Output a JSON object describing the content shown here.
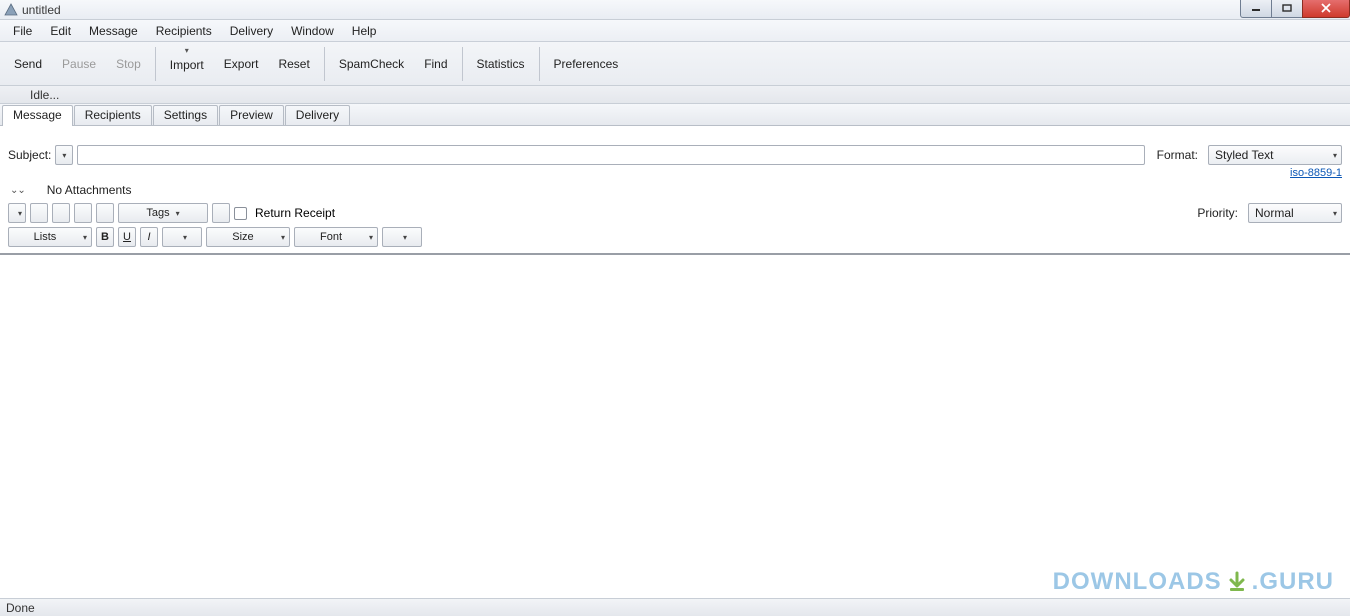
{
  "window": {
    "title": "untitled"
  },
  "menubar": [
    "File",
    "Edit",
    "Message",
    "Recipients",
    "Delivery",
    "Window",
    "Help"
  ],
  "toolbar": {
    "send": "Send",
    "pause": "Pause",
    "stop": "Stop",
    "import": "Import",
    "export": "Export",
    "reset": "Reset",
    "spamcheck": "SpamCheck",
    "find": "Find",
    "statistics": "Statistics",
    "preferences": "Preferences"
  },
  "status_idle": "Idle...",
  "tabs": [
    "Message",
    "Recipients",
    "Settings",
    "Preview",
    "Delivery"
  ],
  "subject_label": "Subject:",
  "subject_value": "",
  "format_label": "Format:",
  "format_value": "Styled Text",
  "encoding_link": "iso-8859-1",
  "attachments_label": "No Attachments",
  "return_receipt_label": "Return Receipt",
  "priority_label": "Priority:",
  "priority_value": "Normal",
  "tags_label": "Tags",
  "lists_label": "Lists",
  "size_label": "Size",
  "font_label": "Font",
  "bold_label": "B",
  "underline_label": "U",
  "italic_label": "I",
  "bottom_status": "Done",
  "watermark": {
    "left": "DOWNLOADS",
    "right": ".GURU"
  }
}
